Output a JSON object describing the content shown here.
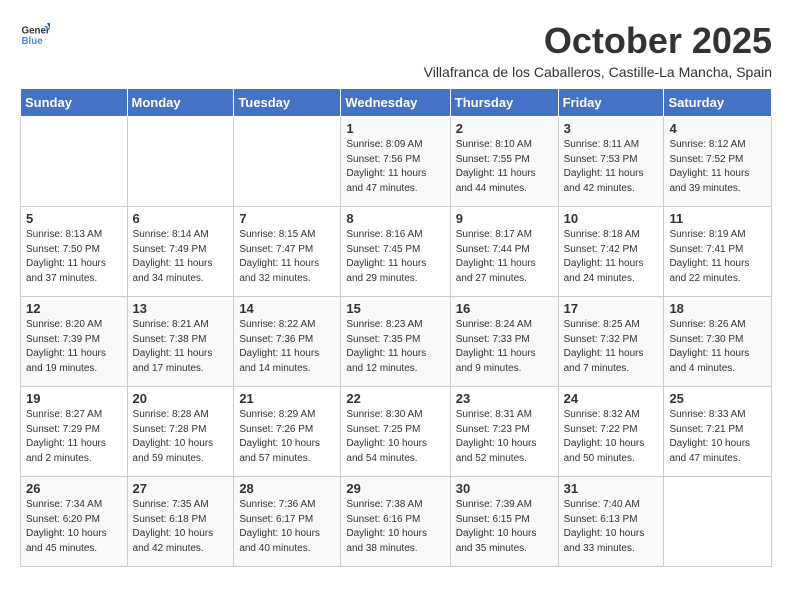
{
  "header": {
    "logo_general": "General",
    "logo_blue": "Blue",
    "month_title": "October 2025",
    "subtitle": "Villafranca de los Caballeros, Castille-La Mancha, Spain"
  },
  "weekdays": [
    "Sunday",
    "Monday",
    "Tuesday",
    "Wednesday",
    "Thursday",
    "Friday",
    "Saturday"
  ],
  "weeks": [
    [
      {
        "day": "",
        "info": ""
      },
      {
        "day": "",
        "info": ""
      },
      {
        "day": "",
        "info": ""
      },
      {
        "day": "1",
        "info": "Sunrise: 8:09 AM\nSunset: 7:56 PM\nDaylight: 11 hours\nand 47 minutes."
      },
      {
        "day": "2",
        "info": "Sunrise: 8:10 AM\nSunset: 7:55 PM\nDaylight: 11 hours\nand 44 minutes."
      },
      {
        "day": "3",
        "info": "Sunrise: 8:11 AM\nSunset: 7:53 PM\nDaylight: 11 hours\nand 42 minutes."
      },
      {
        "day": "4",
        "info": "Sunrise: 8:12 AM\nSunset: 7:52 PM\nDaylight: 11 hours\nand 39 minutes."
      }
    ],
    [
      {
        "day": "5",
        "info": "Sunrise: 8:13 AM\nSunset: 7:50 PM\nDaylight: 11 hours\nand 37 minutes."
      },
      {
        "day": "6",
        "info": "Sunrise: 8:14 AM\nSunset: 7:49 PM\nDaylight: 11 hours\nand 34 minutes."
      },
      {
        "day": "7",
        "info": "Sunrise: 8:15 AM\nSunset: 7:47 PM\nDaylight: 11 hours\nand 32 minutes."
      },
      {
        "day": "8",
        "info": "Sunrise: 8:16 AM\nSunset: 7:45 PM\nDaylight: 11 hours\nand 29 minutes."
      },
      {
        "day": "9",
        "info": "Sunrise: 8:17 AM\nSunset: 7:44 PM\nDaylight: 11 hours\nand 27 minutes."
      },
      {
        "day": "10",
        "info": "Sunrise: 8:18 AM\nSunset: 7:42 PM\nDaylight: 11 hours\nand 24 minutes."
      },
      {
        "day": "11",
        "info": "Sunrise: 8:19 AM\nSunset: 7:41 PM\nDaylight: 11 hours\nand 22 minutes."
      }
    ],
    [
      {
        "day": "12",
        "info": "Sunrise: 8:20 AM\nSunset: 7:39 PM\nDaylight: 11 hours\nand 19 minutes."
      },
      {
        "day": "13",
        "info": "Sunrise: 8:21 AM\nSunset: 7:38 PM\nDaylight: 11 hours\nand 17 minutes."
      },
      {
        "day": "14",
        "info": "Sunrise: 8:22 AM\nSunset: 7:36 PM\nDaylight: 11 hours\nand 14 minutes."
      },
      {
        "day": "15",
        "info": "Sunrise: 8:23 AM\nSunset: 7:35 PM\nDaylight: 11 hours\nand 12 minutes."
      },
      {
        "day": "16",
        "info": "Sunrise: 8:24 AM\nSunset: 7:33 PM\nDaylight: 11 hours\nand 9 minutes."
      },
      {
        "day": "17",
        "info": "Sunrise: 8:25 AM\nSunset: 7:32 PM\nDaylight: 11 hours\nand 7 minutes."
      },
      {
        "day": "18",
        "info": "Sunrise: 8:26 AM\nSunset: 7:30 PM\nDaylight: 11 hours\nand 4 minutes."
      }
    ],
    [
      {
        "day": "19",
        "info": "Sunrise: 8:27 AM\nSunset: 7:29 PM\nDaylight: 11 hours\nand 2 minutes."
      },
      {
        "day": "20",
        "info": "Sunrise: 8:28 AM\nSunset: 7:28 PM\nDaylight: 10 hours\nand 59 minutes."
      },
      {
        "day": "21",
        "info": "Sunrise: 8:29 AM\nSunset: 7:26 PM\nDaylight: 10 hours\nand 57 minutes."
      },
      {
        "day": "22",
        "info": "Sunrise: 8:30 AM\nSunset: 7:25 PM\nDaylight: 10 hours\nand 54 minutes."
      },
      {
        "day": "23",
        "info": "Sunrise: 8:31 AM\nSunset: 7:23 PM\nDaylight: 10 hours\nand 52 minutes."
      },
      {
        "day": "24",
        "info": "Sunrise: 8:32 AM\nSunset: 7:22 PM\nDaylight: 10 hours\nand 50 minutes."
      },
      {
        "day": "25",
        "info": "Sunrise: 8:33 AM\nSunset: 7:21 PM\nDaylight: 10 hours\nand 47 minutes."
      }
    ],
    [
      {
        "day": "26",
        "info": "Sunrise: 7:34 AM\nSunset: 6:20 PM\nDaylight: 10 hours\nand 45 minutes."
      },
      {
        "day": "27",
        "info": "Sunrise: 7:35 AM\nSunset: 6:18 PM\nDaylight: 10 hours\nand 42 minutes."
      },
      {
        "day": "28",
        "info": "Sunrise: 7:36 AM\nSunset: 6:17 PM\nDaylight: 10 hours\nand 40 minutes."
      },
      {
        "day": "29",
        "info": "Sunrise: 7:38 AM\nSunset: 6:16 PM\nDaylight: 10 hours\nand 38 minutes."
      },
      {
        "day": "30",
        "info": "Sunrise: 7:39 AM\nSunset: 6:15 PM\nDaylight: 10 hours\nand 35 minutes."
      },
      {
        "day": "31",
        "info": "Sunrise: 7:40 AM\nSunset: 6:13 PM\nDaylight: 10 hours\nand 33 minutes."
      },
      {
        "day": "",
        "info": ""
      }
    ]
  ]
}
